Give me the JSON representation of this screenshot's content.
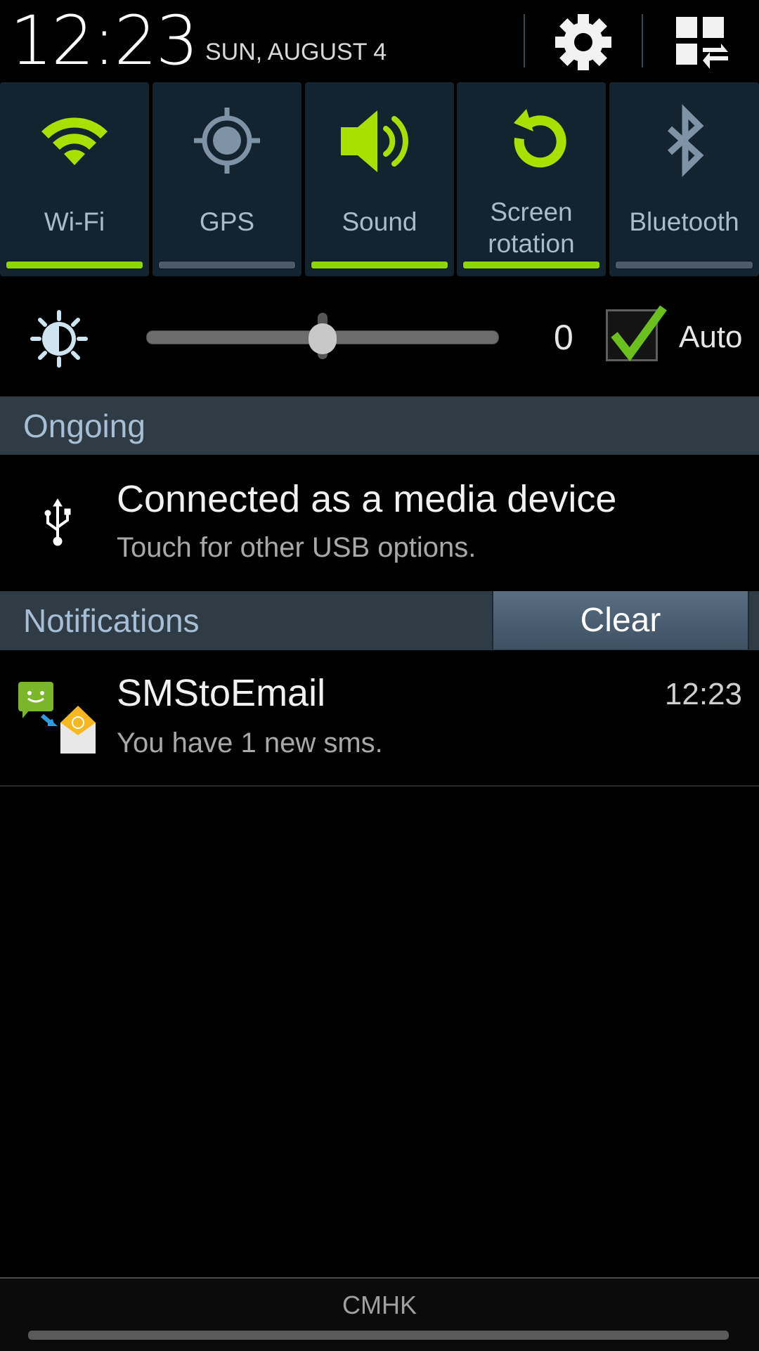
{
  "header": {
    "time": "12:23",
    "date": "SUN, AUGUST 4",
    "settings_icon": "gear-icon",
    "edit_icon": "quick-settings-grid-icon"
  },
  "quick_settings": [
    {
      "label": "Wi-Fi",
      "icon": "wifi-icon",
      "enabled": true
    },
    {
      "label": "GPS",
      "icon": "gps-icon",
      "enabled": false
    },
    {
      "label": "Sound",
      "icon": "sound-icon",
      "enabled": true
    },
    {
      "label": "Screen rotation",
      "label_line1": "Screen",
      "label_line2": "rotation",
      "icon": "rotation-icon",
      "enabled": true
    },
    {
      "label": "Bluetooth",
      "icon": "bluetooth-icon",
      "enabled": false
    }
  ],
  "brightness": {
    "value_label": "0",
    "slider_fraction": 0.5,
    "auto_label": "Auto",
    "auto_checked": true
  },
  "ongoing": {
    "header": "Ongoing",
    "items": [
      {
        "icon": "usb-icon",
        "title": "Connected as a media device",
        "subtitle": "Touch for other USB options."
      }
    ]
  },
  "notifications": {
    "header": "Notifications",
    "clear_label": "Clear",
    "items": [
      {
        "icon": "sms-to-email-icon",
        "title": "SMStoEmail",
        "subtitle": "You have 1 new sms.",
        "time": "12:23"
      }
    ]
  },
  "footer": {
    "carrier": "CMHK"
  },
  "colors": {
    "accent_on": "#8ed600",
    "accent_off": "#4b5b69",
    "tile_bg": "#13232f",
    "section_bg": "#2f3b45",
    "section_text": "#a7bfd5"
  }
}
